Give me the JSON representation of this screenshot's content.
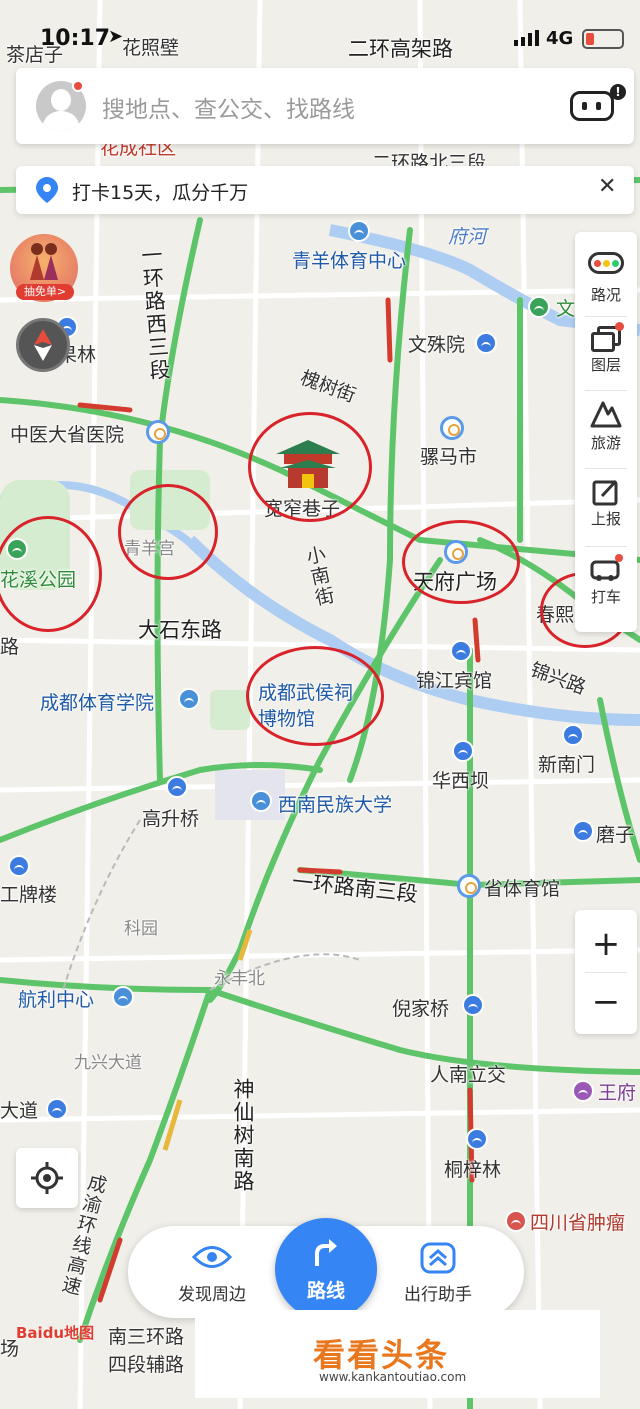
{
  "status_bar": {
    "time": "10:17",
    "network": "4G"
  },
  "search": {
    "placeholder": "搜地点、查公交、找路线"
  },
  "banner": {
    "text": "打卡15天，瓜分千万"
  },
  "promo": {
    "label": "抽免单>"
  },
  "right_toolbar": {
    "items": [
      {
        "label": "路况",
        "icon": "traffic-icon"
      },
      {
        "label": "图层",
        "icon": "layers-icon"
      },
      {
        "label": "旅游",
        "icon": "travel-icon"
      },
      {
        "label": "上报",
        "icon": "report-icon"
      },
      {
        "label": "打车",
        "icon": "taxi-icon"
      }
    ]
  },
  "zoom": {
    "in": "+",
    "out": "−"
  },
  "bottom_nav": {
    "discover": "发现周边",
    "route": "路线",
    "assistant": "出行助手"
  },
  "baidu_logo": {
    "text": "Baidu地图"
  },
  "watermark": {
    "title": "看看头条",
    "url": "www.kankantoutiao.com"
  },
  "map_labels": {
    "cha_dian_zi": "茶店子",
    "hua_zhao_bi": "花照壁",
    "erhuan_gaojia": "二环高架路",
    "huacheng_shequ": "花成社区",
    "erhuan_bei_san": "二环路北三段",
    "fu_he": "府河",
    "qingyang_tiyu": "青羊体育中心",
    "guo_lin": "果林",
    "wenshu_yuan": "文殊院",
    "wen": "文",
    "huaishu_jie": "槐树街",
    "zhongyi_daxue": "中医大省医院",
    "luoma_shi": "骡马市",
    "kuanzhai": "宽窄巷子",
    "qingyang_gong": "青羊宫",
    "huanxi_gongyuan": "花溪公园",
    "xiaonan_jie": "小南街",
    "tianfu_guangchang": "天府广场",
    "chunxi_lu": "春熙路",
    "dashi_dong_lu": "大石东路",
    "jinjiang": "锦江宾馆",
    "jinxing_lu": "锦兴路",
    "chengdu_tiyu": "成都体育学院",
    "wuhou_ci_1": "成都武侯祠",
    "wuhou_ci_2": "博物馆",
    "xinnan_men": "新南门",
    "huaxi_ba": "华西坝",
    "gaosheng_qiao": "高升桥",
    "xinan_minzu": "西南民族大学",
    "mo_zi": "磨子",
    "yihuan_nan_san": "一环路南三段",
    "sheng_tiyu": "省体育馆",
    "pai_lou": "工牌楼",
    "ke_yuan": "科园",
    "yong_feng_bei": "永丰北",
    "hangli_zhongxin": "航利中心",
    "nijia_qiao": "倪家桥",
    "jiuxing_dadao": "九兴大道",
    "ren_nan_li_jiao": "人南立交",
    "wang_fu": "王府",
    "da_dao": "大道",
    "shenxian_shu": "神仙树南路",
    "tong_zi_lin": "桐梓林",
    "sichuan_zhongliu": "四川省肿瘤",
    "chengyu_huanxian": "成渝环线高速",
    "nansan_huan": "南三环路",
    "siduan_fu": "四段辅路",
    "yihuan_xi_san": "一环路西三段",
    "lu": "路",
    "chang": "场"
  }
}
